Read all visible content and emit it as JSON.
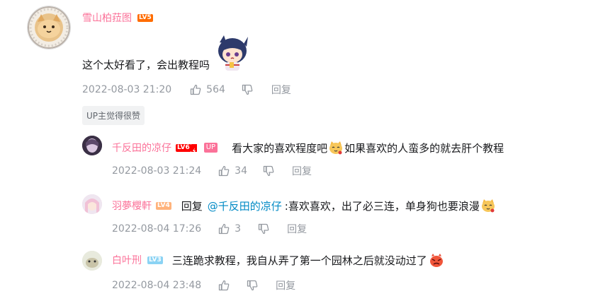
{
  "comment": {
    "username": "雪山柏菈图",
    "level": "LV5",
    "text": "这个太好看了，会出教程吗",
    "date": "2022-08-03 21:20",
    "likes": "564",
    "reply_label": "回复",
    "tag": "UP主觉得很赞"
  },
  "replies": [
    {
      "username": "千反田的凉仔",
      "level": "LV6",
      "up_badge": "UP",
      "text_before": "看大家的喜欢程度吧",
      "text_after": "如果喜欢的人蛮多的就去肝个教程",
      "date": "2022-08-03 21:24",
      "likes": "34",
      "reply_label": "回复"
    },
    {
      "username": "羽夢櫻軒",
      "level": "LV4",
      "text_prefix": "回复",
      "mention": "@千反田的凉仔",
      "text": ":喜欢喜欢，出了必三连，单身狗也要浪漫",
      "date": "2022-08-04 17:26",
      "likes": "3",
      "reply_label": "回复"
    },
    {
      "username": "白叶刑",
      "level": "LV3",
      "text": "三连跪求教程，我自从弄了第一个园林之后就没动过了",
      "date": "2022-08-04 23:48",
      "reply_label": "回复"
    }
  ],
  "colors": {
    "username": "#fb7299",
    "meta": "#9499a0",
    "link": "#008ac5",
    "lv3": "#8bd3f4",
    "lv4": "#ffb37c",
    "lv5": "#ff6c00",
    "lv6": "#ff0000"
  }
}
